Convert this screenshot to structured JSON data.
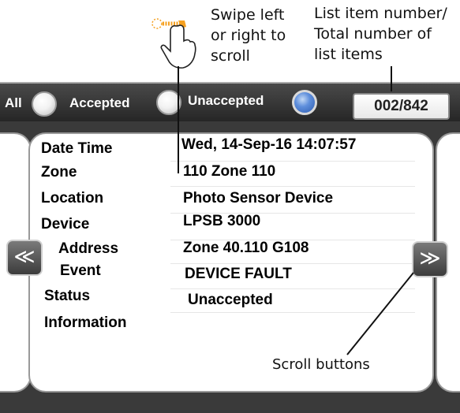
{
  "callouts": {
    "swipe_line1": "Swipe left",
    "swipe_line2": "or right to",
    "swipe_line3": "scroll",
    "count_line1": "List item number/",
    "count_line2": "Total number of",
    "count_line3": "list items",
    "scroll_buttons": "Scroll buttons"
  },
  "filter_bar": {
    "all_label": "All",
    "accepted_label": "Accepted",
    "unaccepted_label": "Unaccepted",
    "selected": "Unaccepted",
    "counter": "002/842"
  },
  "record": {
    "date_time_label": "Date Time",
    "date_time_value": "Wed, 14-Sep-16 14:07:57",
    "zone_label": "Zone",
    "zone_value": "110 Zone 110",
    "location_label": "Location",
    "location_value": "Photo Sensor Device",
    "device_label": "Device",
    "device_value": "LPSB 3000",
    "address_label": "Address",
    "address_value": "Zone 40.110 G108",
    "event_label": "Event",
    "event_value": "DEVICE FAULT",
    "status_label": "Status",
    "status_value": "Unaccepted",
    "information_label": "Information",
    "information_value": ""
  },
  "nav": {
    "prev_glyph": "≪",
    "next_glyph": "≫"
  },
  "colors": {
    "frame": "#3a3a3a",
    "selected_radio": "#3d6cc4",
    "gesture_accent": "#f5a020"
  }
}
